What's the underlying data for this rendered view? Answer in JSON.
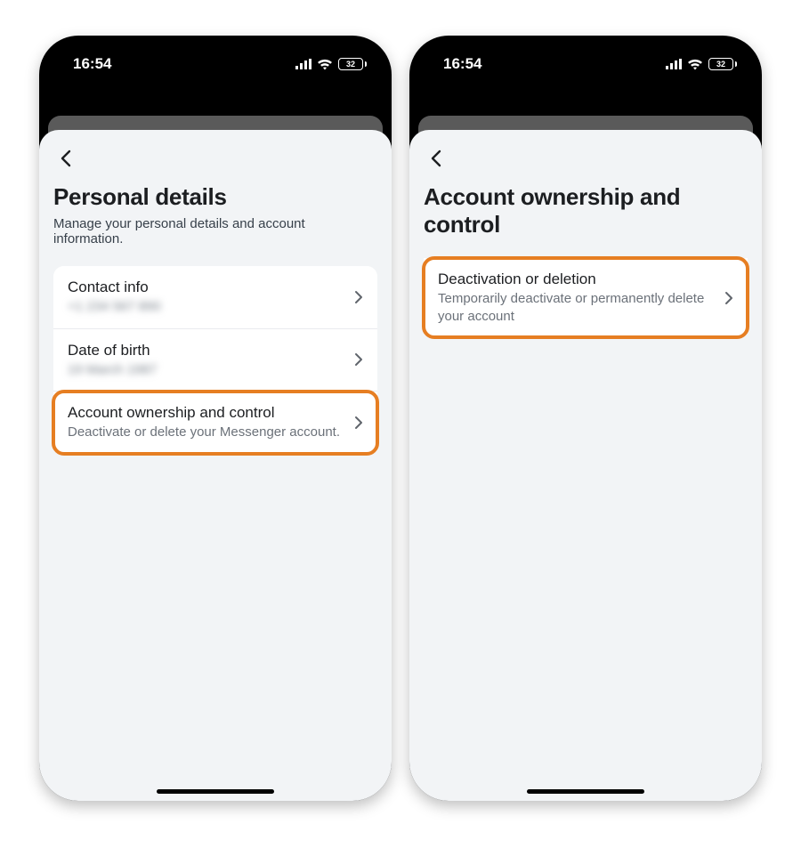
{
  "status": {
    "time": "16:54",
    "battery_pct": "32"
  },
  "left": {
    "title": "Personal details",
    "subtitle": "Manage your personal details and account information.",
    "rows": {
      "contact": {
        "title": "Contact info",
        "sub": "+1 234 567 890"
      },
      "dob": {
        "title": "Date of birth",
        "sub": "19 March 1987"
      },
      "ownership": {
        "title": "Account ownership and control",
        "sub": "Deactivate or delete your Messenger account."
      }
    }
  },
  "right": {
    "title": "Account ownership and control",
    "row": {
      "title": "Deactivation or deletion",
      "sub": "Temporarily deactivate or permanently delete your account"
    }
  },
  "colors": {
    "highlight": "#e67e22"
  }
}
